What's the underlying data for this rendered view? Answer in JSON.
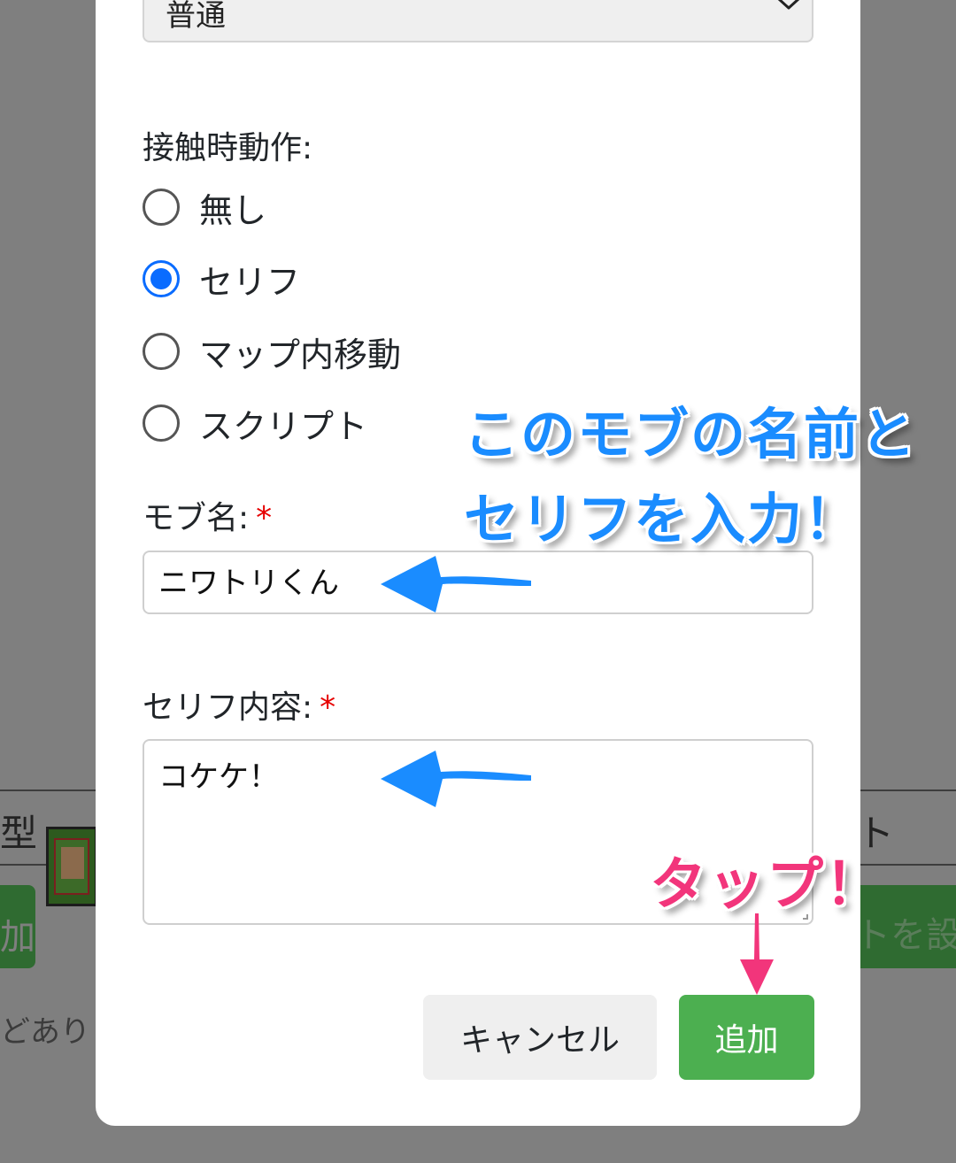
{
  "background": {
    "left_fragment": "型",
    "right_fragment": "ト",
    "right_button_label": "トを設定",
    "left_button_label": "加",
    "note_text": "どありませ"
  },
  "modal": {
    "speed_select": {
      "value": "普通"
    },
    "contact_action": {
      "label": "接触時動作:",
      "options": [
        {
          "label": "無し",
          "checked": false
        },
        {
          "label": "セリフ",
          "checked": true
        },
        {
          "label": "マップ内移動",
          "checked": false
        },
        {
          "label": "スクリプト",
          "checked": false
        }
      ]
    },
    "mob_name": {
      "label": "モブ名:",
      "required_mark": "*",
      "value": "ニワトリくん"
    },
    "dialogue": {
      "label": "セリフ内容:",
      "required_mark": "*",
      "value": "コケケ！"
    },
    "buttons": {
      "cancel": "キャンセル",
      "add": "追加"
    }
  },
  "annotations": {
    "line1": "このモブの名前と",
    "line2": "セリフを入力！",
    "tap": "タップ！",
    "colors": {
      "blue": "#1a8cff",
      "pink": "#f2357b"
    }
  },
  "colors": {
    "accent_blue": "#0a6cff",
    "add_green": "#4caf50",
    "required_red": "#e60000"
  }
}
